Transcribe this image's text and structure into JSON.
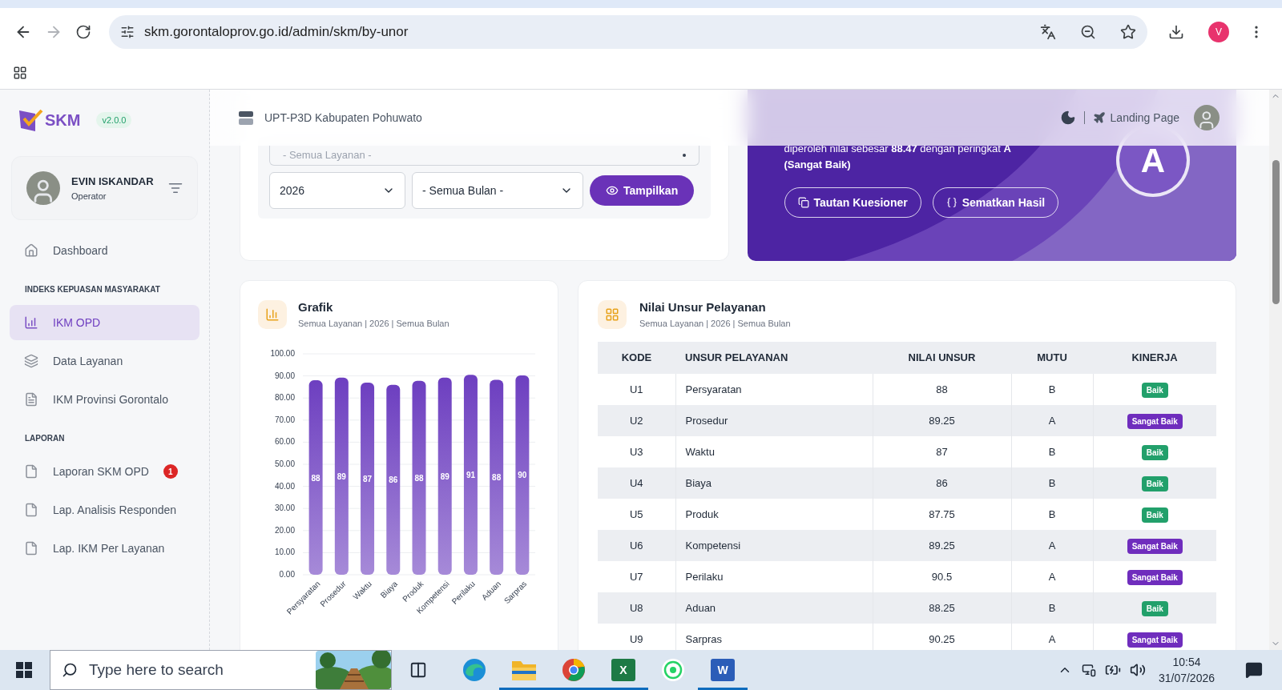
{
  "browser": {
    "url": "skm.gorontaloprov.go.id/admin/skm/by-unor",
    "profile_initial": "V"
  },
  "sidebar": {
    "logo_text": "SKM",
    "version": "v2.0.0",
    "user": {
      "name": "EVIN ISKANDAR",
      "role": "Operator"
    },
    "items": [
      {
        "kind": "link",
        "label": "Dashboard",
        "selected": false
      },
      {
        "kind": "heading",
        "label": "INDEKS KEPUASAN MASYARAKAT"
      },
      {
        "kind": "link",
        "label": "IKM OPD",
        "selected": true
      },
      {
        "kind": "link",
        "label": "Data Layanan",
        "selected": false
      },
      {
        "kind": "link",
        "label": "IKM Provinsi Gorontalo",
        "selected": false
      },
      {
        "kind": "heading",
        "label": "LAPORAN"
      },
      {
        "kind": "link",
        "label": "Laporan SKM OPD",
        "selected": false,
        "badge": "1"
      },
      {
        "kind": "link",
        "label": "Lap. Analisis Responden",
        "selected": false
      },
      {
        "kind": "link",
        "label": "Lap. IKM Per Layanan",
        "selected": false
      }
    ]
  },
  "header": {
    "unit": "UPT-P3D Kabupaten Pohuwato",
    "landing_link": "Landing Page"
  },
  "filters": {
    "layanan": "- Semua Layanan -",
    "year": "2026",
    "month": "- Semua Bulan -",
    "submit": "Tampilkan"
  },
  "result_card": {
    "summary": "diperoleh nilai sebesar **88.47** dengan peringkat **A** **(Sangat Baik)**",
    "grade": "A",
    "buttons": [
      "Tautan Kuesioner",
      "Sematkan Hasil"
    ]
  },
  "chart_card": {
    "title": "Grafik",
    "subtitle": "Semua Layanan | 2026 | Semua Bulan",
    "chart_data": {
      "type": "bar",
      "categories": [
        "Persyaratan",
        "Prosedur",
        "Waktu",
        "Biaya",
        "Produk",
        "Kompetensi",
        "Perilaku",
        "Aduan",
        "Sarpras"
      ],
      "values": [
        88,
        89.25,
        87,
        86,
        87.75,
        89.25,
        90.5,
        88.25,
        90.25
      ],
      "value_labels": [
        "88",
        "89",
        "87",
        "86",
        "88",
        "89",
        "91",
        "88",
        "90"
      ],
      "ylim": [
        0,
        100
      ],
      "grid": true,
      "yticks": [
        {
          "value": 0,
          "label": "0.00"
        },
        {
          "value": 10,
          "label": "10.00"
        },
        {
          "value": 20,
          "label": "20.00"
        },
        {
          "value": 30,
          "label": "30.00"
        },
        {
          "value": 40,
          "label": "40.00"
        },
        {
          "value": 50,
          "label": "50.00"
        },
        {
          "value": 60,
          "label": "60.00"
        },
        {
          "value": 70,
          "label": "70.00"
        },
        {
          "value": 80,
          "label": "80.00"
        },
        {
          "value": 90,
          "label": "90.00"
        },
        {
          "value": 100,
          "label": "100.00"
        }
      ]
    }
  },
  "table": {
    "title": "Nilai Unsur Pelayanan",
    "subtitle": "Semua Layanan | 2026 | Semua Bulan",
    "columns": [
      "KODE",
      "UNSUR PELAYANAN",
      "NILAI UNSUR",
      "MUTU",
      "KINERJA"
    ],
    "rows": [
      {
        "kode": "U1",
        "unsur": "Persyaratan",
        "nilai": "88",
        "mutu": "B",
        "kinerja": {
          "label": "Baik",
          "color": "#22a06b"
        }
      },
      {
        "kode": "U2",
        "unsur": "Prosedur",
        "nilai": "89.25",
        "mutu": "A",
        "kinerja": {
          "label": "Sangat Baik",
          "color": "#6f2dbd"
        }
      },
      {
        "kode": "U3",
        "unsur": "Waktu",
        "nilai": "87",
        "mutu": "B",
        "kinerja": {
          "label": "Baik",
          "color": "#22a06b"
        }
      },
      {
        "kode": "U4",
        "unsur": "Biaya",
        "nilai": "86",
        "mutu": "B",
        "kinerja": {
          "label": "Baik",
          "color": "#22a06b"
        }
      },
      {
        "kode": "U5",
        "unsur": "Produk",
        "nilai": "87.75",
        "mutu": "B",
        "kinerja": {
          "label": "Baik",
          "color": "#22a06b"
        }
      },
      {
        "kode": "U6",
        "unsur": "Kompetensi",
        "nilai": "89.25",
        "mutu": "A",
        "kinerja": {
          "label": "Sangat Baik",
          "color": "#6f2dbd"
        }
      },
      {
        "kode": "U7",
        "unsur": "Perilaku",
        "nilai": "90.5",
        "mutu": "A",
        "kinerja": {
          "label": "Sangat Baik",
          "color": "#6f2dbd"
        }
      },
      {
        "kode": "U8",
        "unsur": "Aduan",
        "nilai": "88.25",
        "mutu": "B",
        "kinerja": {
          "label": "Baik",
          "color": "#22a06b"
        }
      },
      {
        "kode": "U9",
        "unsur": "Sarpras",
        "nilai": "90.25",
        "mutu": "A",
        "kinerja": {
          "label": "Sangat Baik",
          "color": "#6f2dbd"
        }
      }
    ]
  },
  "taskbar": {
    "search_placeholder": "Type here to search",
    "spreadsheet_letter": "X",
    "document_letter": "W",
    "time": "10:54",
    "date": "31/07/2026"
  }
}
